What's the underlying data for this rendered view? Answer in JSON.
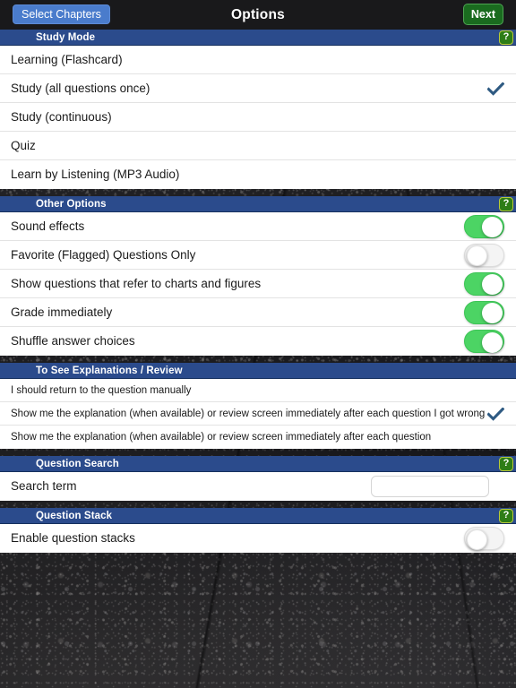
{
  "navbar": {
    "title": "Options",
    "left_button": "Select Chapters",
    "right_button": "Next",
    "accent_blue": "#4a7ccc",
    "accent_green": "#1a6b1f",
    "background": "#19191b"
  },
  "theme": {
    "section_header_blue": "#2b4b8c",
    "toggle_on_green": "#4cd464",
    "checkmark_blue": "#2e5a82",
    "help_badge_green": "#2e7d16",
    "help_badge_border": "#b9c93a",
    "row_background": "#ffffff"
  },
  "help_label": "?",
  "checkmark_glyph": "✔",
  "sections": [
    {
      "id": "study-mode",
      "title": "Study Mode",
      "has_help": true,
      "rows": [
        {
          "label": "Learning (Flashcard)",
          "checked": false
        },
        {
          "label": "Study (all questions once)",
          "checked": true
        },
        {
          "label": "Study (continuous)",
          "checked": false
        },
        {
          "label": "Quiz",
          "checked": false
        },
        {
          "label": "Learn by Listening (MP3 Audio)",
          "checked": false
        }
      ]
    },
    {
      "id": "other-options",
      "title": "Other Options",
      "has_help": true,
      "rows": [
        {
          "label": "Sound effects",
          "toggle": "on"
        },
        {
          "label": "Favorite (Flagged) Questions Only",
          "toggle": "off"
        },
        {
          "label": "Show questions that refer to charts and figures",
          "toggle": "on"
        },
        {
          "label": "Grade immediately",
          "toggle": "on"
        },
        {
          "label": "Shuffle answer choices",
          "toggle": "on"
        }
      ]
    },
    {
      "id": "explanations-review",
      "title": "To See Explanations / Review",
      "has_help": false,
      "compact": true,
      "rows": [
        {
          "label": "I should return to the question manually",
          "checked": false
        },
        {
          "label": "Show me the explanation (when available) or review screen immediately after each question I got wrong",
          "checked": true
        },
        {
          "label": "Show me the explanation (when available) or review screen immediately after each question",
          "checked": false
        }
      ]
    },
    {
      "id": "question-search",
      "title": "Question Search",
      "has_help": true,
      "rows": [
        {
          "label": "Search term",
          "input": {
            "value": "",
            "placeholder": ""
          }
        }
      ]
    },
    {
      "id": "question-stack",
      "title": "Question Stack",
      "has_help": true,
      "rows": [
        {
          "label": "Enable question stacks",
          "toggle": "off"
        }
      ]
    }
  ]
}
